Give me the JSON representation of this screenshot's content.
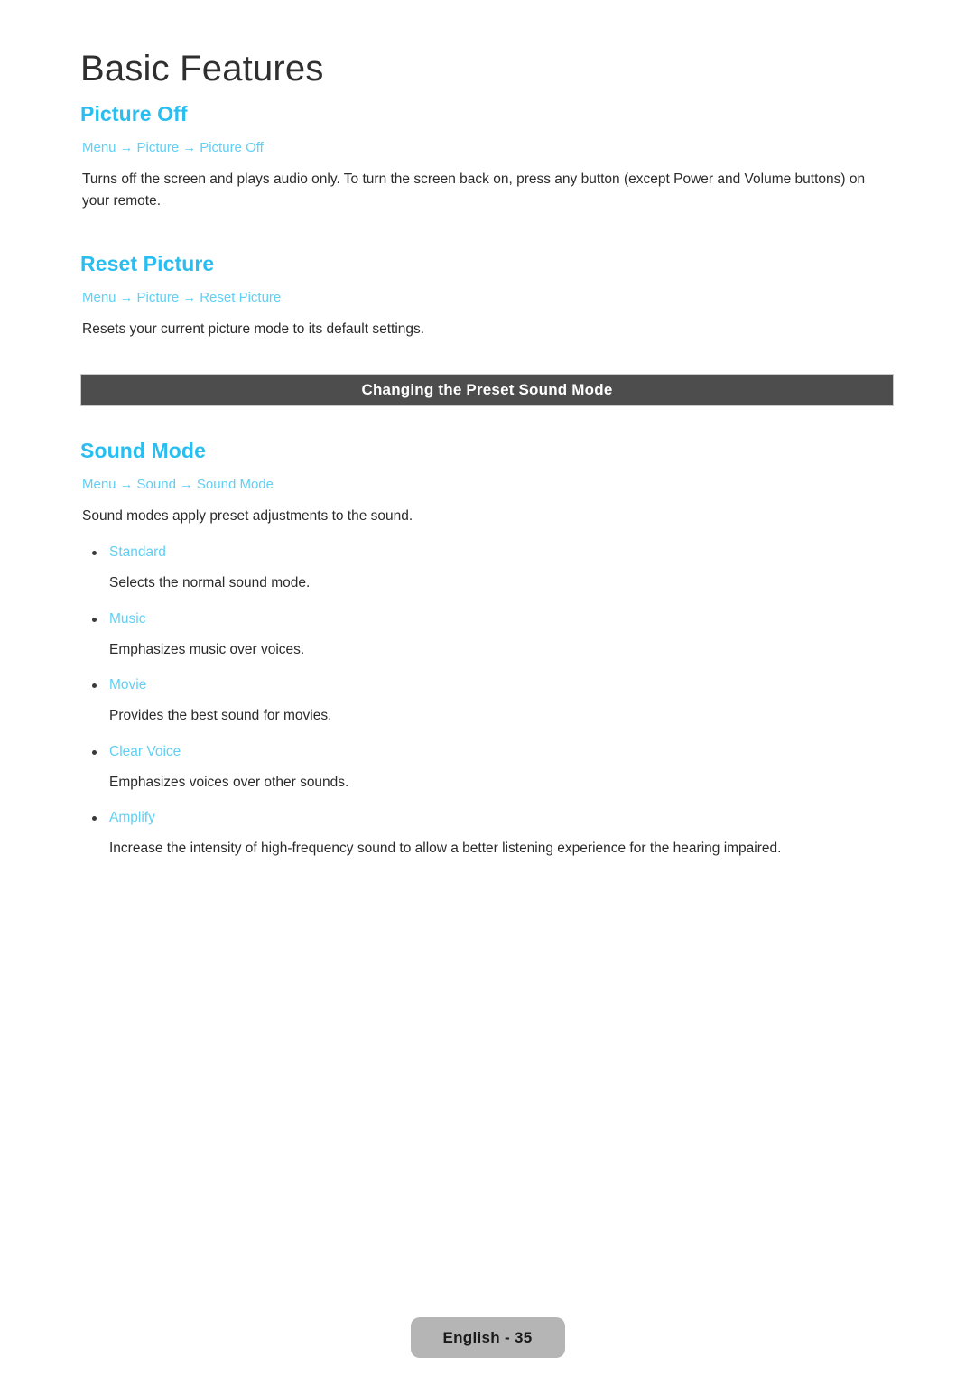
{
  "chapter": {
    "title": "Basic Features"
  },
  "sections": [
    {
      "heading": "Picture Off",
      "breadcrumb": [
        "Menu",
        "Picture",
        "Picture Off"
      ],
      "body": "Turns off the screen and plays audio only. To turn the screen back on, press any button (except Power and Volume buttons) on your remote."
    },
    {
      "heading": "Reset Picture",
      "breadcrumb": [
        "Menu",
        "Picture",
        "Reset Picture"
      ],
      "body": "Resets your current picture mode to its default settings."
    }
  ],
  "banner": {
    "text": "Changing the Preset Sound Mode"
  },
  "sound_section": {
    "heading": "Sound Mode",
    "breadcrumb": [
      "Menu",
      "Sound",
      "Sound Mode"
    ],
    "body": "Sound modes apply preset adjustments to the sound.",
    "modes": [
      {
        "term": "Standard",
        "description": "Selects the normal sound mode."
      },
      {
        "term": "Music",
        "description": "Emphasizes music over voices."
      },
      {
        "term": "Movie",
        "description": "Provides the best sound for movies."
      },
      {
        "term": "Clear Voice",
        "description": "Emphasizes voices over other sounds."
      },
      {
        "term": "Amplify",
        "description": "Increase the intensity of high-frequency sound to allow a better listening experience for the hearing impaired."
      }
    ]
  },
  "footer": {
    "page_label": "English - 35"
  },
  "colors": {
    "heading_cyan": "#29bdf0",
    "link_cyan": "#5fcff5",
    "banner_bg": "#4d4d4d",
    "badge_bg": "#b5b5b5",
    "body_text": "#2b2b2b"
  },
  "arrow_glyph": "→"
}
